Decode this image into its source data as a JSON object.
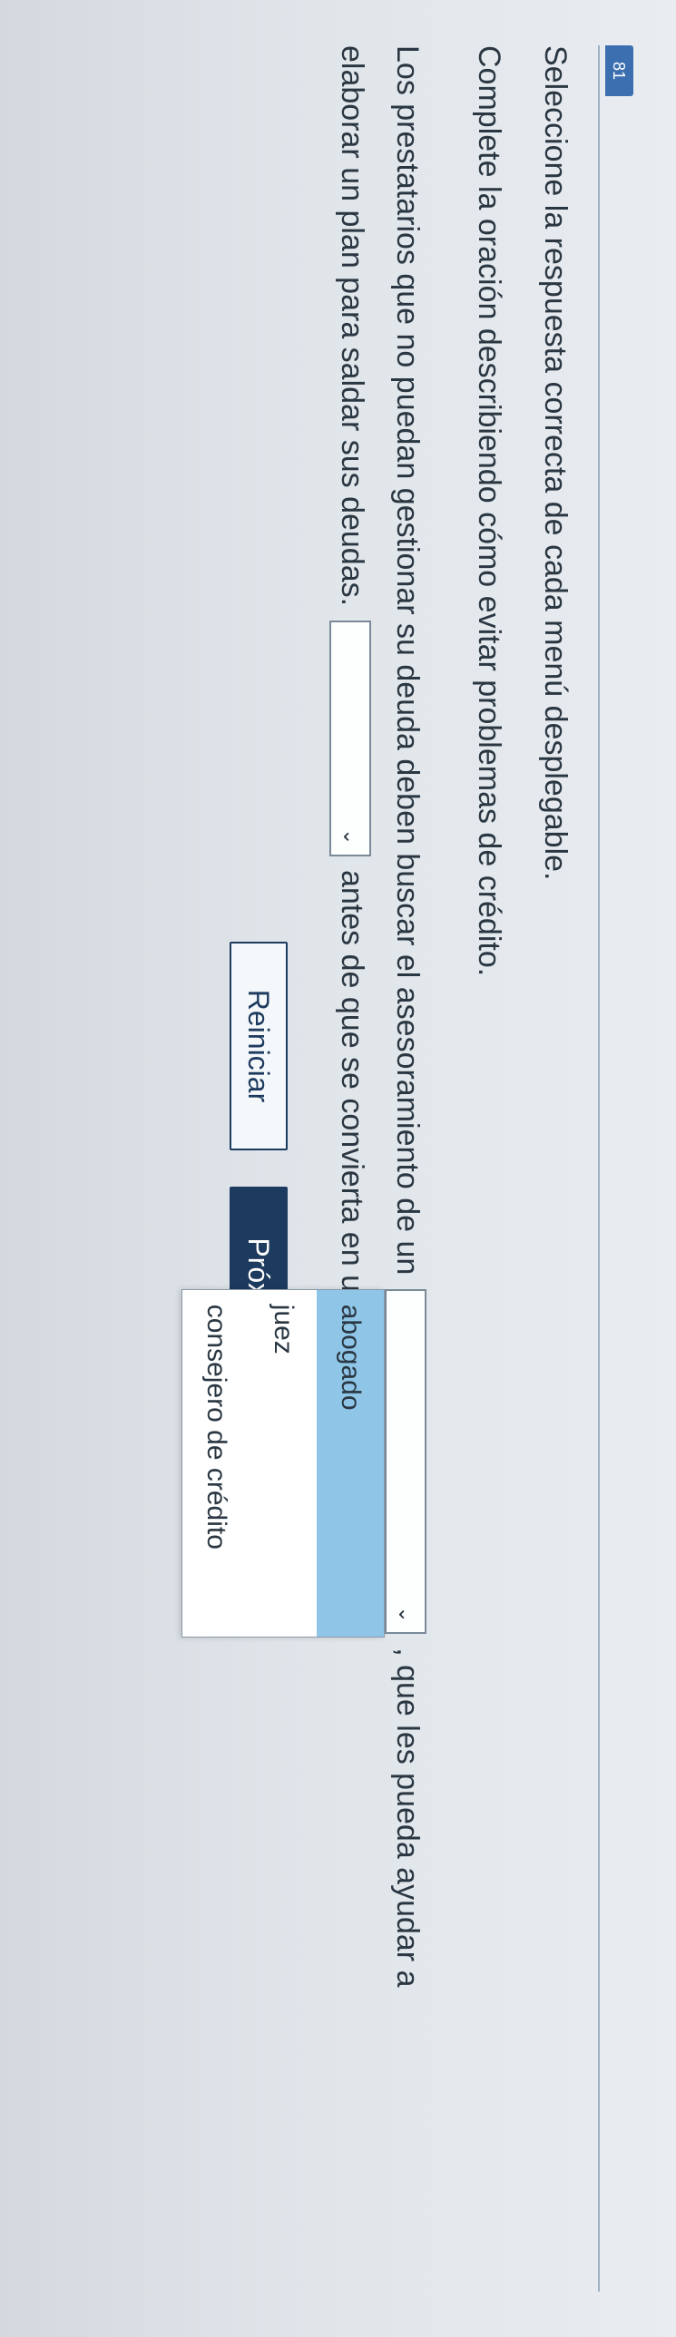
{
  "tab": {
    "label": "81"
  },
  "instruction": "Seleccione la respuesta correcta de cada menú desplegable.",
  "subinstruction": "Complete la oración describiendo cómo evitar problemas de crédito.",
  "sentence": {
    "part1": "Los prestatarios que no puedan gestionar su deuda deben buscar el asesoramiento de un",
    "part2_after_dd1": ", que les pueda ayudar a",
    "line2_start": "elaborar un plan para saldar sus deudas.",
    "part3_after_dd2": "antes de que se convierta en un pr"
  },
  "dropdown1": {
    "options": [
      {
        "label": "abogado"
      },
      {
        "label": "juez"
      },
      {
        "label": "consejero de crédito"
      }
    ]
  },
  "buttons": {
    "reset": "Reiniciar",
    "next": "Próximo"
  },
  "icons": {
    "chevron": "⌄"
  }
}
